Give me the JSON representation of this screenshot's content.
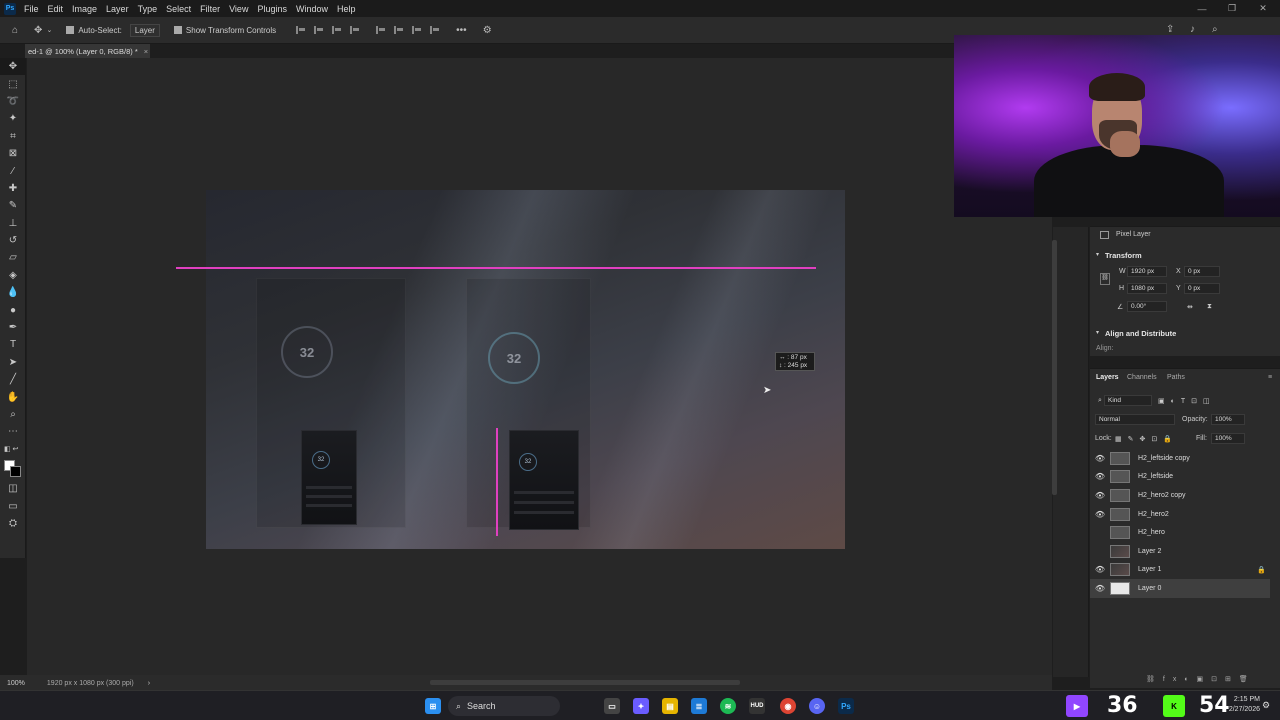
{
  "menubar": {
    "logo": "Ps",
    "items": [
      "File",
      "Edit",
      "Image",
      "Layer",
      "Type",
      "Select",
      "Filter",
      "View",
      "Plugins",
      "Window",
      "Help"
    ]
  },
  "optionsbar": {
    "auto_select_label": "Auto-Select:",
    "auto_select_value": "Layer",
    "show_transform_label": "Show Transform Controls"
  },
  "document": {
    "tab_title": "ed-1 @ 100% (Layer 0, RGB/8) *",
    "tab_close": "×"
  },
  "canvas": {
    "gauge_value": "32",
    "measure_line1": "↔ : 87 px",
    "measure_line2": "↕ : 245 px"
  },
  "properties": {
    "layer_type": "Pixel Layer",
    "transform_heading": "Transform",
    "w_label": "W",
    "w_value": "1920 px",
    "h_label": "H",
    "h_value": "1080 px",
    "x_label": "X",
    "x_value": "0 px",
    "y_label": "Y",
    "y_value": "0 px",
    "angle_value": "0.00°",
    "align_heading": "Align and Distribute",
    "align_label": "Align:"
  },
  "layers_panel": {
    "tabs": [
      "Layers",
      "Channels",
      "Paths"
    ],
    "kind_label": "Kind",
    "blend_mode": "Normal",
    "opacity_label": "Opacity:",
    "opacity_value": "100%",
    "lock_label": "Lock:",
    "fill_label": "Fill:",
    "fill_value": "100%",
    "layers": [
      {
        "name": "H2_leftside copy",
        "visible": true
      },
      {
        "name": "H2_leftside",
        "visible": true
      },
      {
        "name": "H2_hero2 copy",
        "visible": true
      },
      {
        "name": "H2_hero2",
        "visible": true
      },
      {
        "name": "H2_hero",
        "visible": false
      },
      {
        "name": "Layer 2",
        "visible": false
      },
      {
        "name": "Layer 1",
        "visible": true,
        "locked": true
      },
      {
        "name": "Layer 0",
        "visible": true,
        "selected": true
      }
    ]
  },
  "statusbar": {
    "zoom": "100%",
    "doc_info": "1920 px x 1080 px (300 ppi)"
  },
  "taskbar": {
    "search_label": "Search",
    "left_counter": "36",
    "right_counter": "54",
    "clock_time": "2:15 PM",
    "clock_date": "2/27/2026"
  },
  "colors": {
    "guide": "#e040c0",
    "accent_blue": "#31a8ff"
  }
}
